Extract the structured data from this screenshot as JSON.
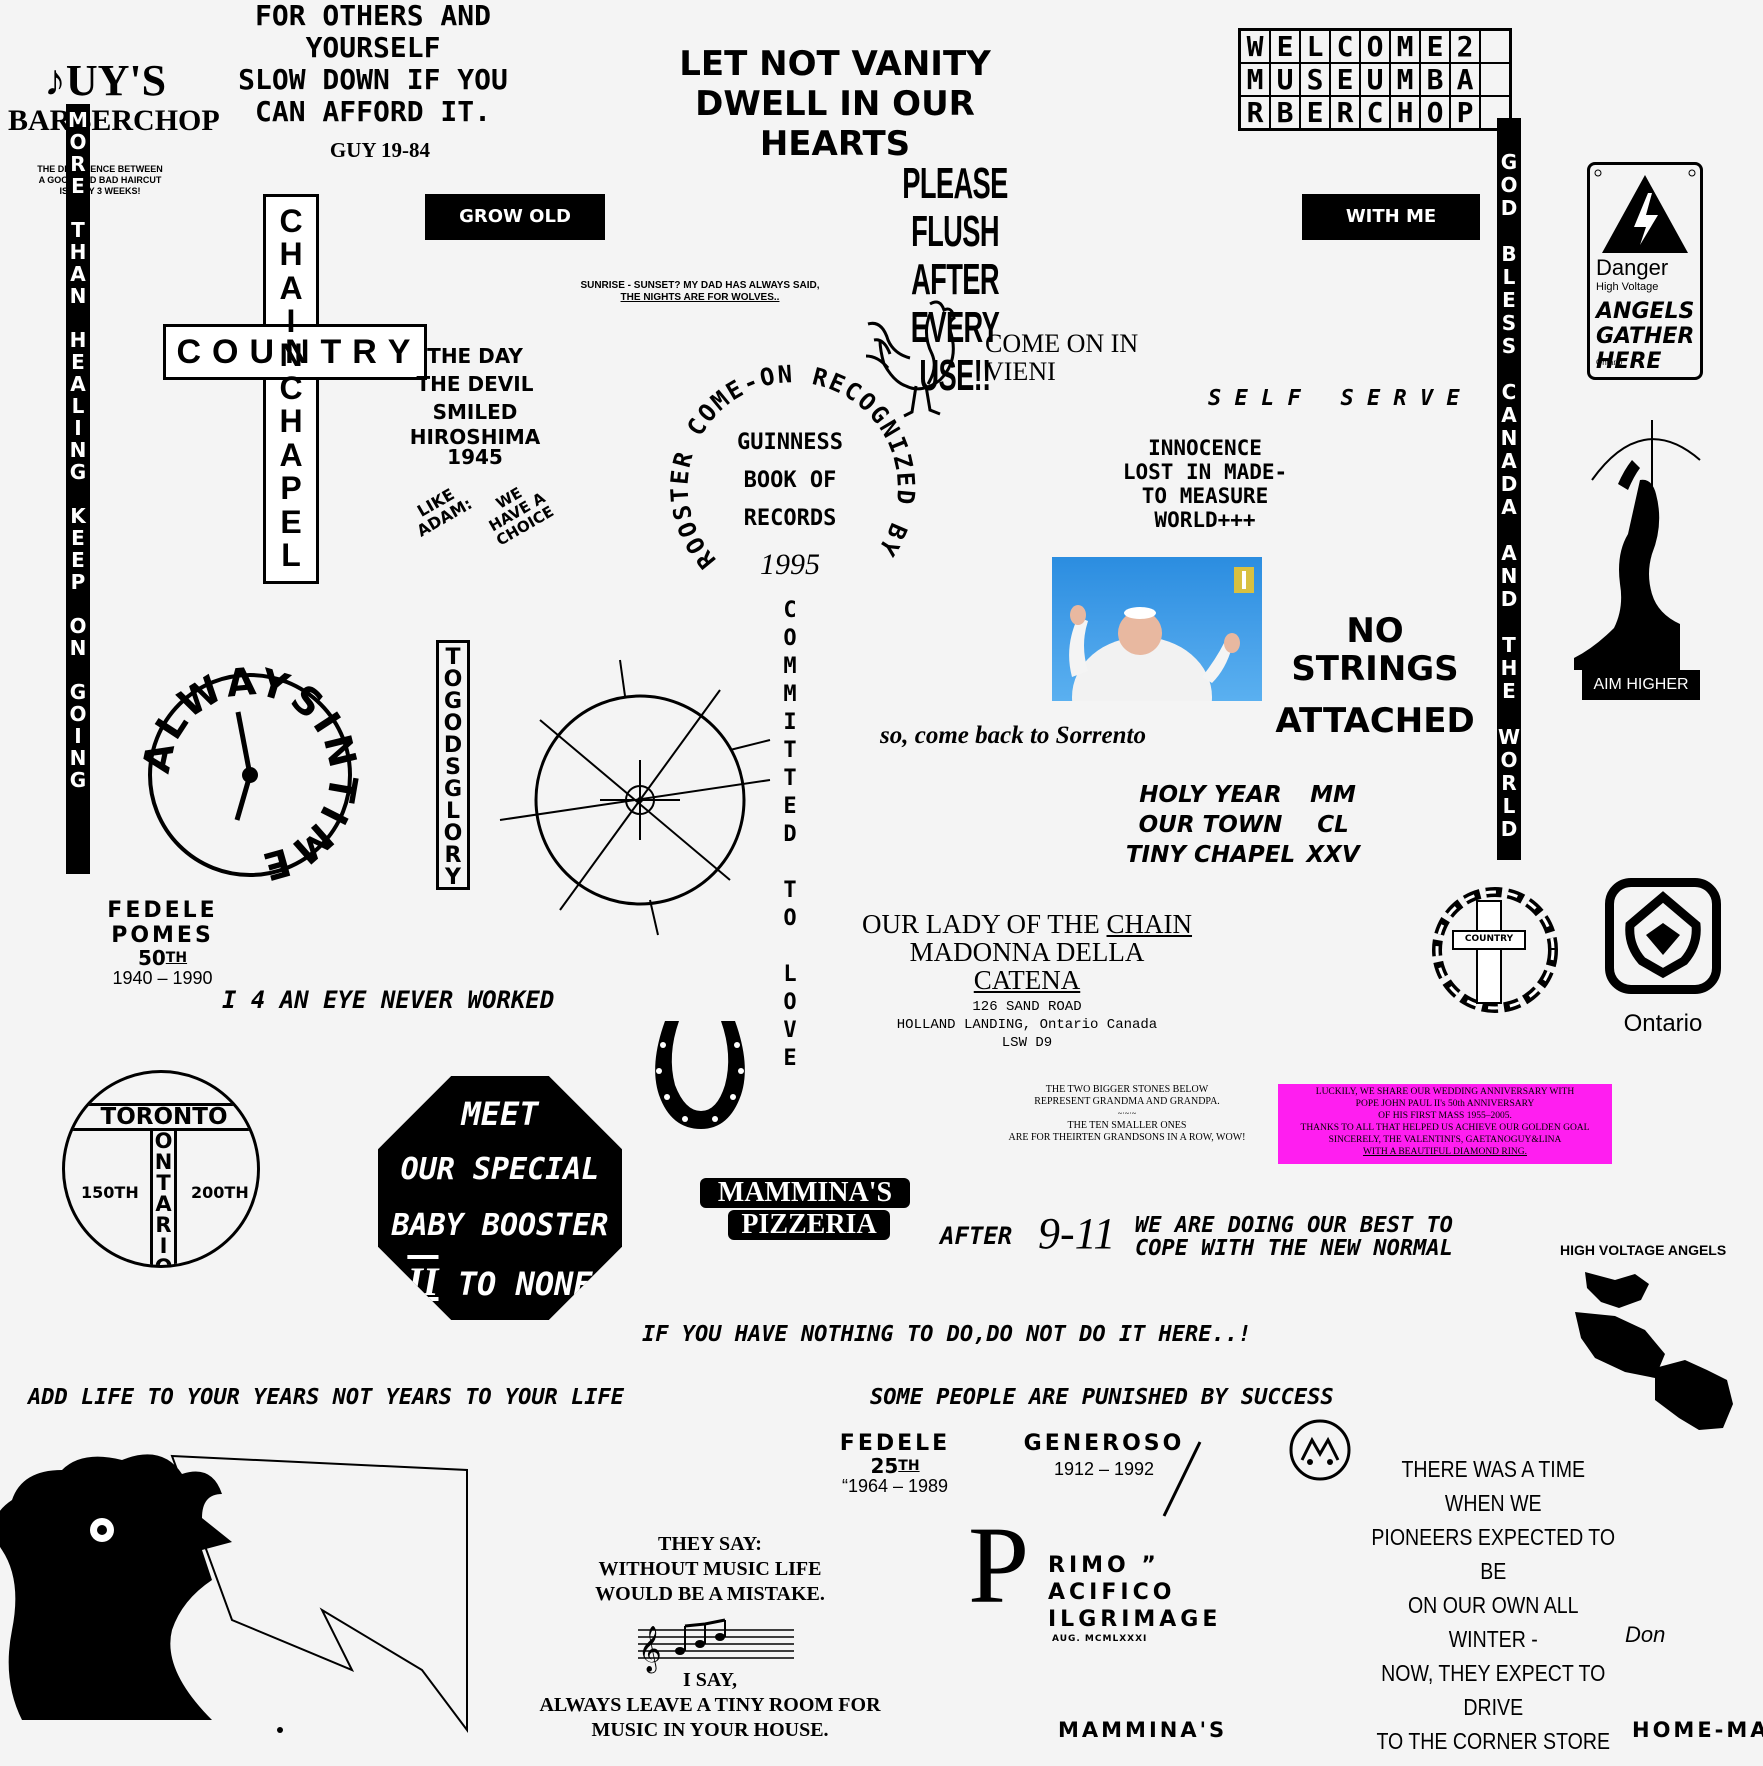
{
  "guys": {
    "title": "♪UY'S",
    "subtitle": "BARBERCHOP",
    "tagline_1": "THE DIFFERENCE BETWEEN",
    "tagline_2": "A GOOD AND BAD HAIRCUT",
    "tagline_3": "IS ONLY 3 WEEKS!"
  },
  "others": {
    "line1": "FOR OTHERS AND",
    "line2": "YOURSELF",
    "line3": "SLOW DOWN IF YOU",
    "line4": "CAN AFFORD IT.",
    "sig": "GUY 19-84"
  },
  "vanity": {
    "line1": "LET NOT VANITY",
    "line2": "DWELL IN OUR HEARTS"
  },
  "welcome": {
    "letters": [
      "W",
      "E",
      "L",
      "C",
      "O",
      "M",
      "E",
      "2",
      "",
      "M",
      "U",
      "S",
      "E",
      "U",
      "M",
      "B",
      "A",
      "",
      "R",
      "B",
      "E",
      "R",
      "C",
      "H",
      "O",
      "P",
      ""
    ]
  },
  "grow_old": "GROW OLD",
  "with_me": "WITH ME",
  "flush": {
    "line1": "PLEASE FLUSH",
    "line2": "AFTER EVERY USE!!"
  },
  "sunrise": {
    "line1": "SUNRISE - SUNSET? MY DAD HAS ALWAYS SAID,",
    "line2": "THE NIGHTS ARE FOR WOLVES.."
  },
  "danger": {
    "title": "Danger",
    "sub": "High Voltage",
    "line1": "ANGELS",
    "line2": "GATHER",
    "line3": "HERE",
    "small": "Ontario"
  },
  "vert_left": "MORE THAN HEALING KEEP ON GOING",
  "cross": {
    "horizontal": "COUNTRY",
    "vertical": "CHAINCHAPEL"
  },
  "devil": {
    "line1": "THE DAY",
    "line2": "THE DEVIL",
    "line3": "SMILED",
    "line4": "HIROSHIMA",
    "line5": "1945"
  },
  "adam": {
    "left1": "LIKE",
    "left2": "ADAM:",
    "right1": "WE",
    "right2": "HAVE A",
    "right3": "CHOICE"
  },
  "rooster_ring": {
    "arc": "ROOSTER COME-ON RECOGNIZED BY",
    "line1": "GUINNESS",
    "line2": "BOOK OF",
    "line3": "RECORDS",
    "year": "1995"
  },
  "come_on": {
    "line1": "COME ON IN",
    "line2": "VIENI"
  },
  "self_serve": "S E L F   S E R V E",
  "god_bless": "GOD BLESS CANADA AND THE WORLD",
  "innocence": {
    "line1": "INNOCENCE",
    "line2": "LOST IN MADE-",
    "line3": "TO MEASURE",
    "line4": "WORLD+++"
  },
  "aim_higher": "AIM HIGHER",
  "no_strings": {
    "line1": "NO",
    "line2": "STRINGS",
    "line3": "ATTACHED"
  },
  "sorrento": "so, come back to Sorrento",
  "clock": {
    "ring": "ALWAYSINTIME"
  },
  "togods": "TOGODSGLORY",
  "committed": "COMMITTED TO LOVE",
  "holy": {
    "rows": [
      {
        "label": "HOLY YEAR",
        "num": "MM"
      },
      {
        "label": "OUR TOWN",
        "num": "CL"
      },
      {
        "label": "TINY CHAPEL",
        "num": "XXV"
      }
    ]
  },
  "fedele_pomes": {
    "name": "FEDELE POMES",
    "anniv": "50",
    "suffix": "TH",
    "years": "1940 – 1990"
  },
  "eye": "I 4 AN EYE NEVER WORKED",
  "our_lady": {
    "line1a": "OUR LADY OF THE ",
    "line1b": "CHAIN",
    "line2a": "MADONNA DELLA ",
    "line2b": "CATENA",
    "addr1": "126 SAND ROAD",
    "addr2": "HOLLAND LANDING, Ontario Canada",
    "addr3": "LSW D9"
  },
  "mini_cross": {
    "h": "COUNTRY",
    "v": "CHAINCHAPEL"
  },
  "ontario": "Ontario",
  "toronto": {
    "name": "TORONTO",
    "vertical": "ONTARIO",
    "left": "150TH",
    "right": "200TH"
  },
  "stop": {
    "line1": "MEET",
    "line2": "OUR SPECIAL",
    "line3": "BABY BOOSTER",
    "line4a": "II",
    "line4b": " TO NONE"
  },
  "stones": {
    "line1": "THE TWO BIGGER STONES BELOW",
    "line2": "REPRESENT GRANDMA AND GRANDPA.",
    "line3": "THE TEN SMALLER ONES",
    "line4": "ARE FOR THEIRTEN GRANDSONS IN A ROW, WOW!"
  },
  "pink": {
    "line1": "LUCKILY, WE SHARE OUR WEDDING ANNIVERSARY WITH",
    "line2": "POPE JOHN PAUL II's 50th ANNIVERSARY",
    "line3": "OF HIS FIRST MASS 1955–2005.",
    "line4": "THANKS TO ALL THAT HELPED US ACHIEVE OUR GOLDEN GOAL",
    "line5": "SINCERELY, THE VALENTINI'S, GAETANOGUY&LINA",
    "line6": "WITH A BEAUTIFUL DIAMOND RING.",
    "color": "#ff1ef0"
  },
  "mammina_pizzeria": {
    "line1": "MAMMINA'S",
    "line2": "PIZZERIA"
  },
  "after911": {
    "pre": "AFTER",
    "date": "9-11",
    "line1": "WE ARE DOING OUR BEST TO",
    "line2": "COPE WITH THE NEW NORMAL"
  },
  "high_voltage_angels": "HIGH VOLTAGE ANGELS",
  "nothing": "IF YOU HAVE NOTHING TO DO,DO NOT DO IT HERE..!",
  "add_life": "ADD LIFE TO YOUR YEARS NOT YEARS TO YOUR LIFE",
  "punished": "SOME PEOPLE ARE PUNISHED BY SUCCESS",
  "fedele25": {
    "name": "FEDELE",
    "num": "25",
    "suffix": "TH",
    "years": "“1964 – 1989"
  },
  "generoso": {
    "name": "GENEROSO",
    "years": "1912 – 1992"
  },
  "pioneers": {
    "line1": "THERE WAS A TIME WHEN WE",
    "line2": "PIONEERS EXPECTED TO BE",
    "line3": "ON OUR OWN ALL WINTER -",
    "line4": "NOW, THEY EXPECT TO DRIVE",
    "line5": "TO THE CORNER STORE",
    "sig": "Don"
  },
  "music": {
    "line1": "THEY SAY:",
    "line2": "WITHOUT MUSIC LIFE",
    "line3": "WOULD BE A MISTAKE.",
    "line4": "I SAY,",
    "line5": "ALWAYS LEAVE A TINY ROOM FOR",
    "line6": "MUSIC IN YOUR HOUSE."
  },
  "primo": {
    "big": "P",
    "line1": "RIMO ”",
    "line2": "ACIFICO",
    "line3": "ILGRIMAGE",
    "date": "AUG. MCMLXXXI"
  },
  "mammina_bottom": "MAMMINA'S",
  "home_ma": "HOME-MA"
}
